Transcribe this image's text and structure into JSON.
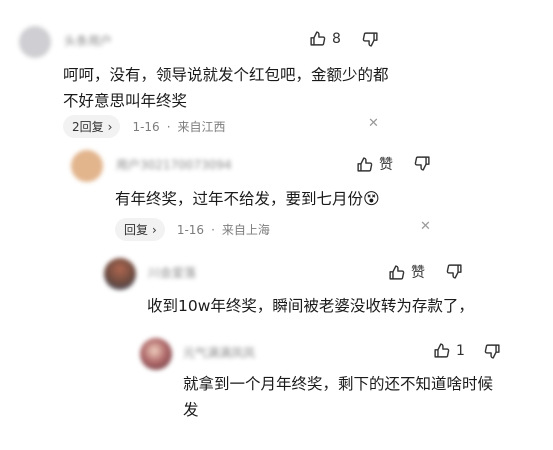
{
  "comments": [
    {
      "username": "头条用户",
      "likes": "8",
      "text": [
        "呵呵，没有，领导说就发个红包吧，金额少的都",
        "不好意思叫年终奖"
      ],
      "reply_label": "2回复",
      "date": "1-16",
      "location": "来自江西",
      "avatar_color": "#cfcfd3"
    },
    {
      "username": "用户302170073094",
      "likes": "赞",
      "text": [
        "有年终奖，过年不给发，要到七月份"
      ],
      "emoji": "😵",
      "reply_label": "回复",
      "date": "1-16",
      "location": "来自上海",
      "avatar_color": "#e2b58d"
    },
    {
      "username": "川会爱落",
      "likes": "赞",
      "text": [
        "收到10w年终奖，瞬间被老婆没收转为存款了，"
      ],
      "avatar_color": "#6b4a3f"
    },
    {
      "username": "元气满满凤凤",
      "likes": "1",
      "text": [
        "就拿到一个月年终奖，剩下的还不知道啥时候",
        "发"
      ],
      "avatar_color": "#8a4f4f"
    }
  ],
  "icons": {
    "like": "thumbs-up-icon",
    "dislike": "thumbs-down-icon",
    "chevron": "chevron-right-icon",
    "close": "close-icon"
  }
}
